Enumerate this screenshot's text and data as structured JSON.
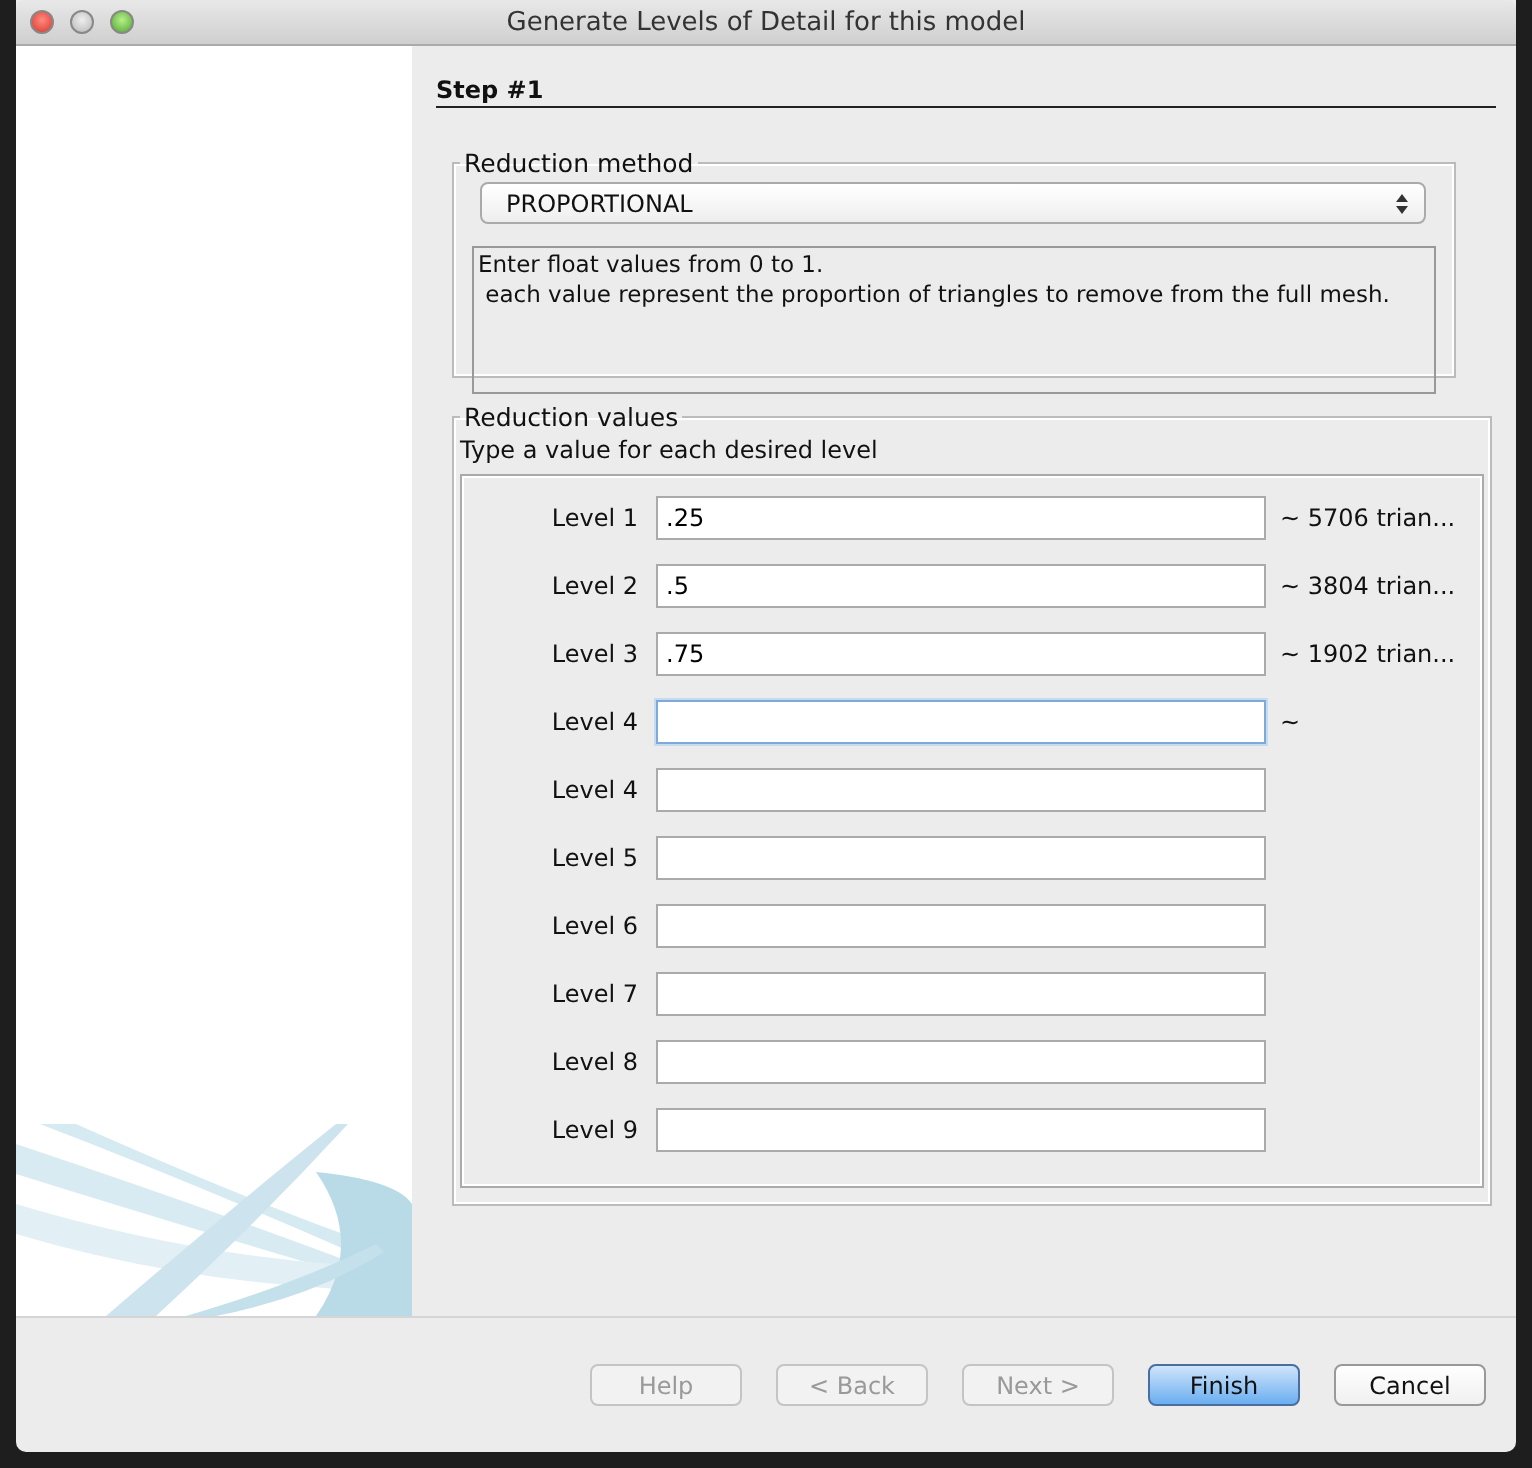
{
  "window": {
    "title": "Generate Levels of Detail for this model"
  },
  "step": {
    "title": "Step #1"
  },
  "reduction_method": {
    "title": "Reduction method",
    "value": "PROPORTIONAL",
    "description": [
      "Enter float values from 0 to 1.",
      " each value represent the proportion of triangles to remove from the full mesh."
    ]
  },
  "reduction_values": {
    "title": "Reduction values",
    "hint": "Type a value for each desired level",
    "rows": [
      {
        "label": "Level 1",
        "value": ".25",
        "result": "~ 5706 trian...",
        "focused": false
      },
      {
        "label": "Level 2",
        "value": ".5",
        "result": "~ 3804 trian...",
        "focused": false
      },
      {
        "label": "Level 3",
        "value": ".75",
        "result": "~ 1902 trian...",
        "focused": false
      },
      {
        "label": "Level 4",
        "value": "",
        "result": "~",
        "focused": true
      },
      {
        "label": "Level 4",
        "value": "",
        "focused": false
      },
      {
        "label": "Level 5",
        "value": "",
        "focused": false
      },
      {
        "label": "Level 6",
        "value": "",
        "focused": false
      },
      {
        "label": "Level 7",
        "value": "",
        "focused": false
      },
      {
        "label": "Level 8",
        "value": "",
        "focused": false
      },
      {
        "label": "Level 9",
        "value": "",
        "focused": false
      }
    ]
  },
  "buttons": [
    {
      "label": "Help",
      "disabled": true,
      "default": false
    },
    {
      "label": "< Back",
      "disabled": true,
      "default": false
    },
    {
      "label": "Next >",
      "disabled": true,
      "default": false
    },
    {
      "label": "Finish",
      "disabled": false,
      "default": true
    },
    {
      "label": "Cancel",
      "disabled": false,
      "default": false
    }
  ]
}
